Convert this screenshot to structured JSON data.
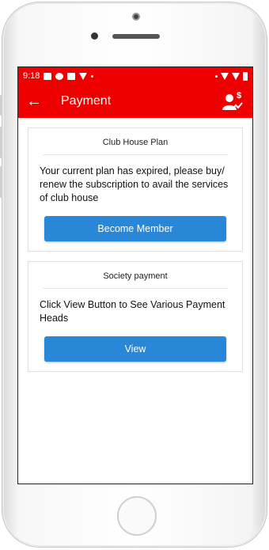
{
  "status_bar": {
    "time": "9:18"
  },
  "app_bar": {
    "title": "Payment"
  },
  "cards": [
    {
      "title": "Club House Plan",
      "text": "Your current plan has expired, please buy/ renew the subscription to avail the services of club house",
      "button_label": "Become Member"
    },
    {
      "title": "Society payment",
      "text": "Click View Button to See Various Payment Heads",
      "button_label": "View"
    }
  ],
  "colors": {
    "accent": "#ee0000",
    "button": "#2a87d8"
  }
}
